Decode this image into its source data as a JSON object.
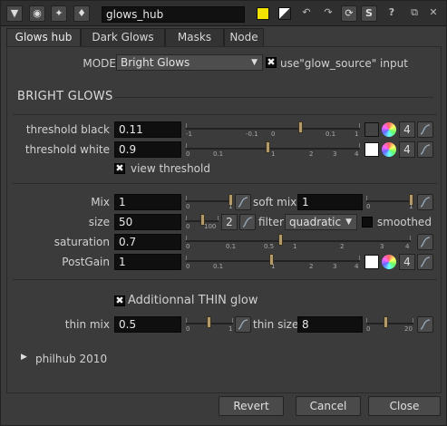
{
  "toolbar": {
    "node_name": "glows_hub",
    "help_label": "?",
    "s_label": "S",
    "colors": {
      "swatch_yellow": "#f2e200",
      "swatch_white": "#ffffff"
    }
  },
  "tabs": [
    {
      "label": "Glows hub"
    },
    {
      "label": "Dark Glows"
    },
    {
      "label": "Masks"
    },
    {
      "label": "Node"
    }
  ],
  "mode": {
    "label": "MODE",
    "value": "Bright Glows",
    "use_input_label": "use\"glow_source\" input",
    "use_input_checked": true
  },
  "bright": {
    "section_title": "BRIGHT GLOWS",
    "threshold_black": {
      "label": "threshold black",
      "value": "0.11",
      "ticks": [
        "-1",
        "-0.1",
        "0",
        "0.1",
        "1"
      ],
      "channels": "4"
    },
    "threshold_white": {
      "label": "threshold white",
      "value": "0.9",
      "ticks": [
        "0",
        "0.1",
        "1",
        "2",
        "3",
        "4"
      ],
      "channels": "4"
    },
    "view_threshold": {
      "label": "view threshold",
      "checked": true
    }
  },
  "params": {
    "mix": {
      "label": "Mix",
      "value": "1",
      "ticks": [
        "0",
        "1"
      ]
    },
    "soft_mix": {
      "label": "soft mix",
      "value": "1",
      "ticks": [
        "0",
        "1"
      ]
    },
    "size": {
      "label": "size",
      "value": "50",
      "ticks": [
        "0",
        "100"
      ],
      "count": "2"
    },
    "filter": {
      "label": "filter",
      "value": "quadratic"
    },
    "smoothed": {
      "label": "smoothed",
      "checked": false
    },
    "saturation": {
      "label": "saturation",
      "value": "0.7",
      "ticks": [
        "0",
        "0.1",
        "0.5",
        "1",
        "2",
        "3",
        "4"
      ]
    },
    "postgain": {
      "label": "PostGain",
      "value": "1",
      "ticks": [
        "0",
        "0.1",
        "1",
        "2",
        "3",
        "4"
      ],
      "channels": "4"
    }
  },
  "thin": {
    "checkbox_label": "Additionnal THIN glow",
    "checked": true,
    "thin_mix": {
      "label": "thin mix",
      "value": "0.5",
      "ticks": [
        "0",
        "1"
      ]
    },
    "thin_size": {
      "label": "thin size",
      "value": "8",
      "ticks": [
        "0",
        "20"
      ]
    }
  },
  "footer": {
    "credit": "philhub 2010",
    "revert": "Revert",
    "cancel": "Cancel",
    "close": "Close"
  }
}
